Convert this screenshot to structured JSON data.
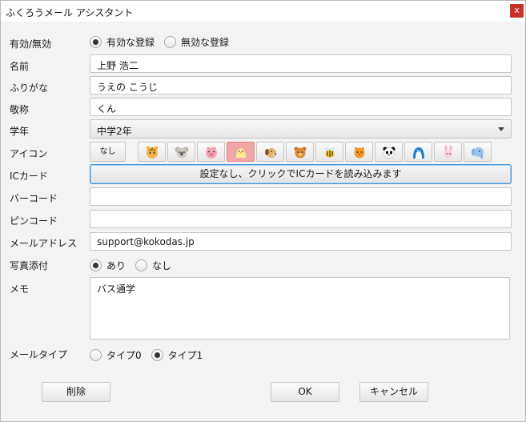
{
  "window": {
    "title": "ふくろうメール アシスタント",
    "close_label": "x"
  },
  "labels": {
    "enabled": "有効/無効",
    "name": "名前",
    "furigana": "ふりがな",
    "honorific": "敬称",
    "grade": "学年",
    "icon": "アイコン",
    "ic_card": "ICカード",
    "barcode": "バーコード",
    "pincode": "ピンコード",
    "email": "メールアドレス",
    "photo": "写真添付",
    "memo": "メモ",
    "mail_type": "メールタイプ"
  },
  "enabled_options": [
    {
      "label": "有効な登録",
      "selected": true
    },
    {
      "label": "無効な登録",
      "selected": false
    }
  ],
  "fields": {
    "name": "上野 浩二",
    "furigana": "うえの こうじ",
    "honorific": "くん",
    "barcode": "",
    "pincode": "",
    "email": "support@kokodas.jp",
    "memo": "バス通学"
  },
  "grade": {
    "selected": "中学2年"
  },
  "icons": {
    "none_label": "なし",
    "items": [
      {
        "name": "tiger",
        "selected": false
      },
      {
        "name": "koala",
        "selected": false
      },
      {
        "name": "pig",
        "selected": false
      },
      {
        "name": "chick",
        "selected": true
      },
      {
        "name": "dog",
        "selected": false
      },
      {
        "name": "bear",
        "selected": false
      },
      {
        "name": "bee",
        "selected": false
      },
      {
        "name": "cat",
        "selected": false
      },
      {
        "name": "panda",
        "selected": false
      },
      {
        "name": "penguin",
        "selected": false
      },
      {
        "name": "rabbit",
        "selected": false
      },
      {
        "name": "elephant",
        "selected": false
      }
    ]
  },
  "ic_card_button": "設定なし、クリックでICカードを読み込みます",
  "photo_options": [
    {
      "label": "あり",
      "selected": true
    },
    {
      "label": "なし",
      "selected": false
    }
  ],
  "mail_type_options": [
    {
      "label": "タイプ0",
      "selected": false
    },
    {
      "label": "タイプ1",
      "selected": true
    }
  ],
  "buttons": {
    "delete": "削除",
    "ok": "OK",
    "cancel": "キャンセル"
  }
}
